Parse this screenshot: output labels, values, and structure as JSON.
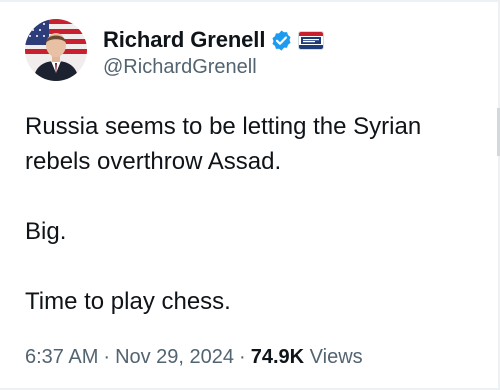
{
  "author": {
    "display_name": "Richard Grenell",
    "handle": "@RichardGrenell",
    "verified_icon": "verified-badge-icon",
    "affiliation_badge": "cpac-affiliation-badge",
    "accent_color": "#1d9bf0"
  },
  "tweet": {
    "lines": [
      "Russia seems to be letting the Syrian",
      "rebels overthrow Assad.",
      "Big.",
      "Time to play chess."
    ]
  },
  "meta": {
    "time": "6:37 AM",
    "separator": "·",
    "date": "Nov 29, 2024",
    "views_count": "74.9K",
    "views_label": "Views"
  }
}
